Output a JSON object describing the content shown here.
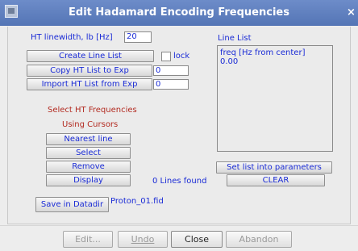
{
  "window": {
    "title": "Edit Hadamard Encoding Frequencies",
    "close_glyph": "×"
  },
  "left": {
    "ht_linewidth_label": "HT linewidth, lb [Hz]",
    "ht_linewidth_value": "20",
    "create_line_list": "Create Line List",
    "lock_label": "lock",
    "copy_ht_list": "Copy HT List to Exp",
    "copy_value": "0",
    "import_ht_list": "Import HT List from Exp",
    "import_value": "0",
    "select_heading_1": "Select HT Frequencies",
    "select_heading_2": "Using Cursors",
    "nearest_line": "Nearest line",
    "select": "Select",
    "remove": "Remove",
    "display": "Display",
    "lines_found": "0 Lines found",
    "save_in_datadir": "Save in Datadir",
    "filename": "Proton_01.fid"
  },
  "right": {
    "line_list_label": "Line List",
    "line_list_text_1": "freq [Hz from center]",
    "line_list_text_2": "0.00",
    "set_list": "Set list into parameters",
    "clear": "CLEAR"
  },
  "footer": {
    "edit": "Edit...",
    "undo": "Undo",
    "close": "Close",
    "abandon": "Abandon"
  },
  "icons": {
    "window_icon": "window-menu-icon",
    "close_icon": "close-icon"
  }
}
